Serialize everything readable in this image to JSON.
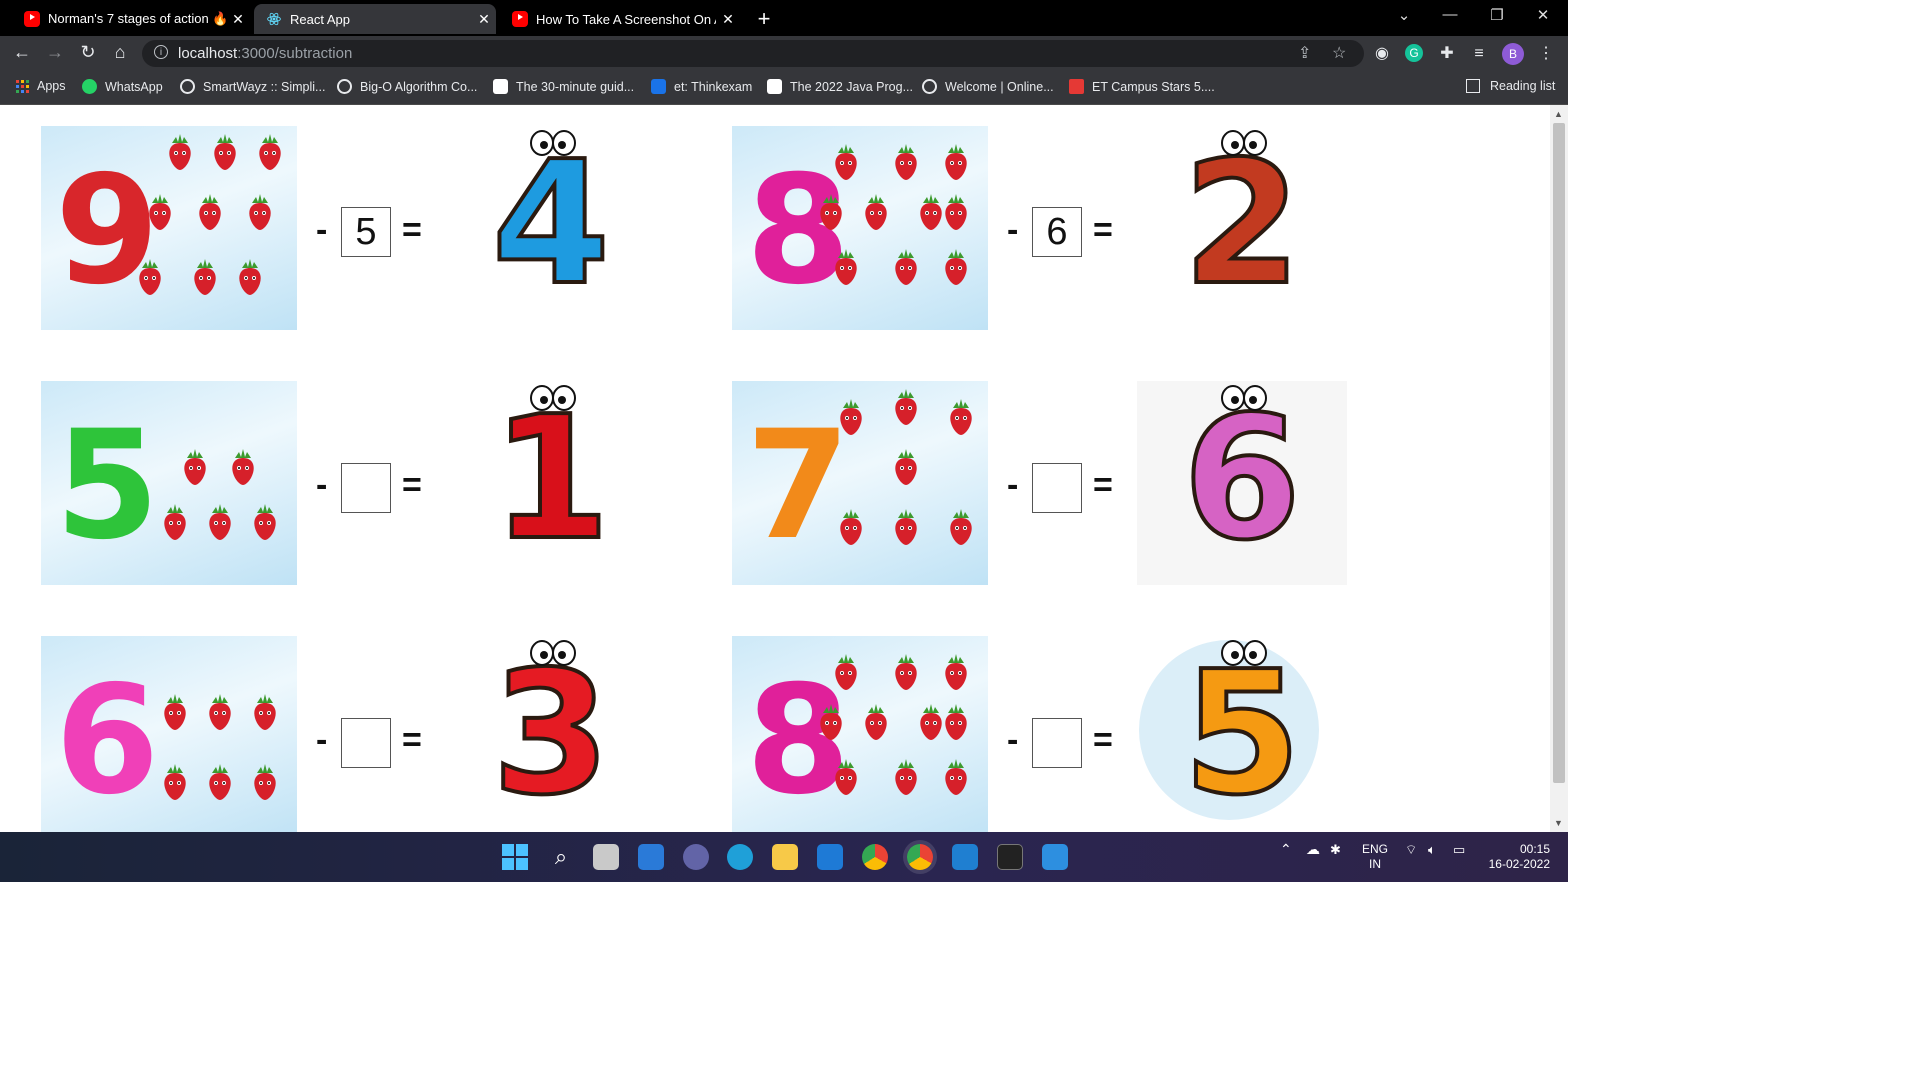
{
  "tabs": [
    {
      "title": "Norman's 7 stages of action 🔥🔥",
      "icon": "youtube-icon",
      "active": false
    },
    {
      "title": "React App",
      "icon": "react-icon",
      "active": true
    },
    {
      "title": "How To Take A Screenshot On A",
      "icon": "youtube-icon",
      "active": false
    }
  ],
  "address": {
    "host": "localhost",
    "path": ":3000/subtraction"
  },
  "bookmarks": [
    {
      "label": "Apps",
      "color": "#e94235"
    },
    {
      "label": "WhatsApp",
      "color": "#25d366"
    },
    {
      "label": "SmartWayz :: Simpli...",
      "color": "#ffffff"
    },
    {
      "label": "Big-O Algorithm Co...",
      "color": "#ffffff"
    },
    {
      "label": "The 30-minute guid...",
      "color": "#ffffff"
    },
    {
      "label": "et: Thinkexam",
      "color": "#1a73e8"
    },
    {
      "label": "The 2022 Java Prog...",
      "color": "#ffffff"
    },
    {
      "label": "Welcome | Online...",
      "color": "#ffffff"
    },
    {
      "label": "ET Campus Stars 5....",
      "color": "#e53935"
    }
  ],
  "reading_list": "Reading list",
  "profile_initial": "B",
  "problems": [
    {
      "minuend": "9",
      "minuend_color": "#d8262b",
      "berries": 9,
      "answer": "5",
      "result": "4",
      "result_color": "#1e9be0"
    },
    {
      "minuend": "8",
      "minuend_color": "#e0209a",
      "berries": 10,
      "answer": "6",
      "result": "2",
      "result_color": "#c23a20"
    },
    {
      "minuend": "5",
      "minuend_color": "#2ec43a",
      "berries": 5,
      "answer": "",
      "result": "1",
      "result_color": "#d8101a"
    },
    {
      "minuend": "7",
      "minuend_color": "#f28a1a",
      "berries": 7,
      "answer": "",
      "result": "6",
      "result_color": "#d663c4"
    },
    {
      "minuend": "6",
      "minuend_color": "#f040b8",
      "berries": 6,
      "answer": "",
      "result": "3",
      "result_color": "#e51b23"
    },
    {
      "minuend": "8",
      "minuend_color": "#e0209a",
      "berries": 10,
      "answer": "",
      "result": "5",
      "result_color": "#f59a12"
    }
  ],
  "operator_minus": "-",
  "operator_equals": "=",
  "tray": {
    "language": "ENG",
    "region": "IN",
    "time": "00:15",
    "date": "16-02-2022"
  }
}
